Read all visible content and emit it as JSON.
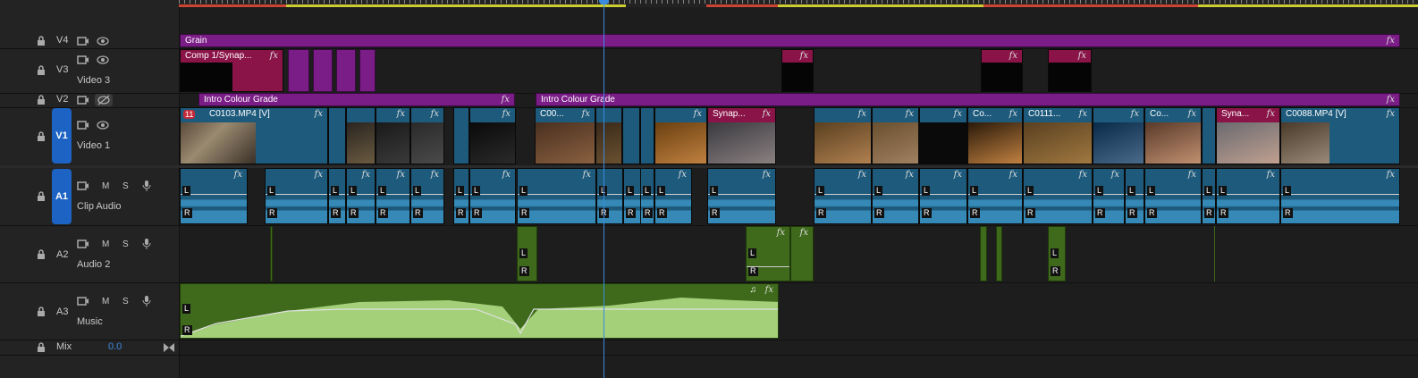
{
  "tracks": {
    "v4": {
      "target": "V4"
    },
    "v3": {
      "target": "V3",
      "name": "Video 3"
    },
    "v2": {
      "target": "V2"
    },
    "v1": {
      "target": "V1",
      "name": "Video 1"
    },
    "a1": {
      "target": "A1",
      "name": "Clip Audio"
    },
    "a2": {
      "target": "A2",
      "name": "Audio 2"
    },
    "a3": {
      "target": "A3",
      "name": "Music"
    },
    "mix": {
      "name": "Mix",
      "value": "0.0"
    }
  },
  "controls": {
    "mute": "M",
    "solo": "S",
    "left": "L",
    "right": "R",
    "fx": "fx"
  },
  "clips": {
    "grain": "Grain",
    "comp1": "Comp 1/Synap...",
    "intro1": "Intro Colour Grade",
    "intro2": "Intro Colour Grade",
    "c0103": "C0103.MP4 [V]",
    "c00": "C00...",
    "synap": "Synap...",
    "co1": "Co...",
    "c0111": "C0111...",
    "co2": "Co...",
    "syna": "Syna...",
    "c0088": "C0088.MP4 [V]",
    "badge": "11"
  },
  "colors": {
    "video_clip": "#1d5a7c",
    "adjustment_clip": "#7a1d86",
    "nested_clip": "#8a1448",
    "music_clip": "#3f6a1c",
    "target_active": "#1c63c4",
    "playhead": "#3a8be0"
  }
}
